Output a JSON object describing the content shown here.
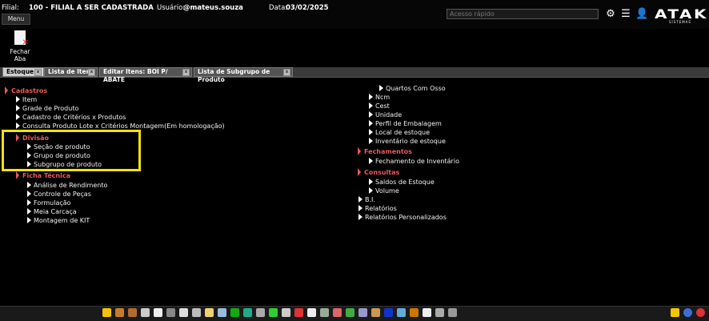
{
  "header": {
    "filial_label": "Filial:",
    "filial_value": "100 - FILIAL A SER CADASTRADA",
    "usuario_label": "Usuário:",
    "usuario_value": "@mateus.souza",
    "data_label": "Data:",
    "data_value": "03/02/2025",
    "search_placeholder": "Acesso rápido",
    "logo": "ATAK",
    "logo_sub": "SISTEMAS",
    "menu_label": "Menu"
  },
  "toolbar": {
    "fechar_aba": "Fechar Aba"
  },
  "tabs": [
    {
      "label": "Estoque",
      "active": true
    },
    {
      "label": "Lista de Itens",
      "active": false
    },
    {
      "label": "Editar Itens: BOI P/ ABATE",
      "active": false
    },
    {
      "label": "Lista de Subgrupo de Produto",
      "active": false
    }
  ],
  "left_tree": {
    "cadastros": {
      "title": "Cadastros",
      "items": [
        "Item",
        "Grade de Produto",
        "Cadastro de Critérios x Produtos",
        "Consulta Produto Lote x Critérios Montagem(Em homologação)"
      ]
    },
    "divisao": {
      "title": "Divisão",
      "items": [
        "Seção de produto",
        "Grupo de produto",
        "Subgrupo de produto"
      ]
    },
    "ficha_tecnica": {
      "title": "Ficha Técnica",
      "items": [
        "Análise de Rendimento",
        "Controle de Peças",
        "Formulação",
        "Meia Carcaça",
        "Montagem de KIT"
      ]
    }
  },
  "right_tree": {
    "cont_items": [
      "Quartos Com Osso"
    ],
    "items": [
      "Ncm",
      "Cest",
      "Unidade",
      "Perfil de Embalagem",
      "Local de estoque",
      "Inventário de estoque"
    ],
    "fechamentos": {
      "title": "Fechamentos",
      "items": [
        "Fechamento de Inventário"
      ]
    },
    "consultas": {
      "title": "Consultas",
      "items": [
        "Saldos de Estoque",
        "Volume"
      ]
    },
    "roots": [
      "B.I.",
      "Relatórios",
      "Relatórios Personalizados"
    ]
  },
  "colors": {
    "section": "#e85a5a",
    "highlight": "#f2e20a",
    "background": "#000000"
  },
  "taskbar_icons": [
    "star-icon",
    "users-icon",
    "box-icon",
    "list-icon",
    "grid-icon",
    "trash-icon",
    "scale-icon",
    "pill-icon",
    "doc-icon",
    "calendar-icon",
    "table-icon",
    "globe-icon",
    "bottle-icon",
    "money-icon",
    "print-icon",
    "truck-icon",
    "file-icon",
    "bottle2-icon",
    "card-icon",
    "chart-icon",
    "book-icon",
    "folder-icon",
    "square-icon",
    "calc-icon",
    "bag-icon",
    "network-icon",
    "headset-icon",
    "refresh-icon"
  ],
  "tray_icons": [
    "favorite-icon",
    "help-icon",
    "power-icon"
  ]
}
